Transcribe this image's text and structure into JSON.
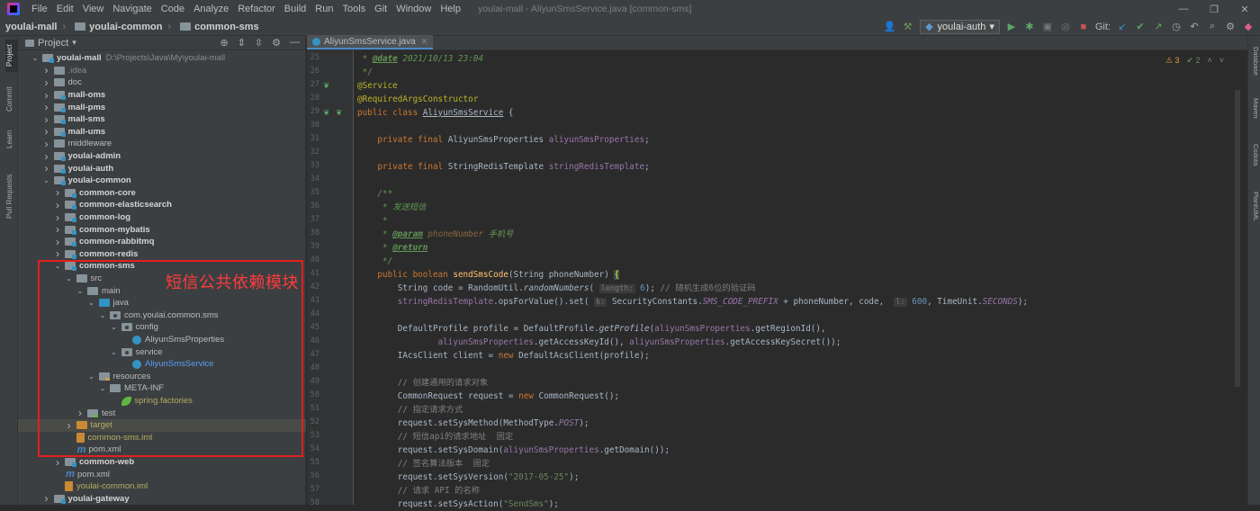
{
  "menu": {
    "items": [
      "File",
      "Edit",
      "View",
      "Navigate",
      "Code",
      "Analyze",
      "Refactor",
      "Build",
      "Run",
      "Tools",
      "Git",
      "Window",
      "Help"
    ],
    "window_title": "youlai-mall - AliyunSmsService.java [common-sms]"
  },
  "breadcrumb": [
    "youlai-mall",
    "youlai-common",
    "common-sms"
  ],
  "toolbar": {
    "run_config": "youlai-auth",
    "git_label": "Git:"
  },
  "project_panel": {
    "title": "Project",
    "tree": [
      {
        "label": "youlai-mall",
        "extra": "D:\\Projects\\Java\\My\\youlai-mall",
        "depth": 0,
        "arrow": "v",
        "icon": "mod",
        "style": "b"
      },
      {
        "label": ".idea",
        "depth": 1,
        "arrow": ">",
        "icon": "plain",
        "style": "idea"
      },
      {
        "label": "doc",
        "depth": 1,
        "arrow": ">",
        "icon": "plain",
        "style": "n"
      },
      {
        "label": "mall-oms",
        "depth": 1,
        "arrow": ">",
        "icon": "mod",
        "style": "b"
      },
      {
        "label": "mall-pms",
        "depth": 1,
        "arrow": ">",
        "icon": "mod",
        "style": "b"
      },
      {
        "label": "mall-sms",
        "depth": 1,
        "arrow": ">",
        "icon": "mod",
        "style": "b"
      },
      {
        "label": "mall-ums",
        "depth": 1,
        "arrow": ">",
        "icon": "mod",
        "style": "b"
      },
      {
        "label": "middleware",
        "depth": 1,
        "arrow": ">",
        "icon": "plain",
        "style": "n"
      },
      {
        "label": "youlai-admin",
        "depth": 1,
        "arrow": ">",
        "icon": "mod",
        "style": "b"
      },
      {
        "label": "youlai-auth",
        "depth": 1,
        "arrow": ">",
        "icon": "mod",
        "style": "b"
      },
      {
        "label": "youlai-common",
        "depth": 1,
        "arrow": "v",
        "icon": "mod",
        "style": "b"
      },
      {
        "label": "common-core",
        "depth": 2,
        "arrow": ">",
        "icon": "mod",
        "style": "b"
      },
      {
        "label": "common-elasticsearch",
        "depth": 2,
        "arrow": ">",
        "icon": "mod",
        "style": "b"
      },
      {
        "label": "common-log",
        "depth": 2,
        "arrow": ">",
        "icon": "mod",
        "style": "b"
      },
      {
        "label": "common-mybatis",
        "depth": 2,
        "arrow": ">",
        "icon": "mod",
        "style": "b"
      },
      {
        "label": "common-rabbitmq",
        "depth": 2,
        "arrow": ">",
        "icon": "mod",
        "style": "b"
      },
      {
        "label": "common-redis",
        "depth": 2,
        "arrow": ">",
        "icon": "mod",
        "style": "b"
      },
      {
        "label": "common-sms",
        "depth": 2,
        "arrow": "v",
        "icon": "mod",
        "style": "b"
      },
      {
        "label": "src",
        "depth": 3,
        "arrow": "v",
        "icon": "plain",
        "style": "n"
      },
      {
        "label": "main",
        "depth": 4,
        "arrow": "v",
        "icon": "plain",
        "style": "n"
      },
      {
        "label": "java",
        "depth": 5,
        "arrow": "v",
        "icon": "blue",
        "style": "n"
      },
      {
        "label": "com.youlai.common.sms",
        "depth": 6,
        "arrow": "v",
        "icon": "pkg",
        "style": "n"
      },
      {
        "label": "config",
        "depth": 7,
        "arrow": "v",
        "icon": "pkg",
        "style": "n"
      },
      {
        "label": "AliyunSmsProperties",
        "depth": 8,
        "arrow": "",
        "icon": "cls",
        "style": "n"
      },
      {
        "label": "service",
        "depth": 7,
        "arrow": "v",
        "icon": "pkg",
        "style": "n"
      },
      {
        "label": "AliyunSmsService",
        "depth": 8,
        "arrow": "",
        "icon": "cls",
        "style": "blueT"
      },
      {
        "label": "resources",
        "depth": 5,
        "arrow": "v",
        "icon": "res",
        "style": "n"
      },
      {
        "label": "META-INF",
        "depth": 6,
        "arrow": "v",
        "icon": "plain",
        "style": "n"
      },
      {
        "label": "spring.factories",
        "depth": 7,
        "arrow": "",
        "icon": "leaf",
        "style": "yel"
      },
      {
        "label": "test",
        "depth": 4,
        "arrow": ">",
        "icon": "test",
        "style": "n"
      },
      {
        "label": "target",
        "depth": 3,
        "arrow": ">",
        "icon": "orange",
        "style": "yel",
        "selected": true
      },
      {
        "label": "common-sms.iml",
        "depth": 3,
        "arrow": "",
        "icon": "iml",
        "style": "yel"
      },
      {
        "label": "pom.xml",
        "depth": 3,
        "arrow": "",
        "icon": "m",
        "style": "n"
      },
      {
        "label": "common-web",
        "depth": 2,
        "arrow": ">",
        "icon": "mod",
        "style": "b"
      },
      {
        "label": "pom.xml",
        "depth": 2,
        "arrow": "",
        "icon": "m",
        "style": "n"
      },
      {
        "label": "youlai-common.iml",
        "depth": 2,
        "arrow": "",
        "icon": "iml",
        "style": "yel"
      },
      {
        "label": "youlai-gateway",
        "depth": 1,
        "arrow": ">",
        "icon": "mod",
        "style": "b"
      }
    ]
  },
  "annotation": "短信公共依赖模块",
  "left_tool_tabs": [
    "Project",
    "Commit",
    "Learn",
    "Pull Requests"
  ],
  "right_tool_tabs": [
    "Database",
    "Maven",
    "Codota",
    "PlantUML"
  ],
  "editor": {
    "tab_label": "AliyunSmsService.java",
    "warnings": {
      "warn_count": "3",
      "ok_count": "2"
    },
    "line_numbers": [
      "25",
      "26",
      "27",
      "28",
      "29",
      "30",
      "31",
      "32",
      "33",
      "34",
      "35",
      "36",
      "37",
      "38",
      "39",
      "40",
      "41",
      "42",
      "43",
      "44",
      "45",
      "46",
      "47",
      "48",
      "49",
      "50",
      "51",
      "52",
      "53",
      "54",
      "55",
      "56",
      "57",
      "58"
    ]
  }
}
